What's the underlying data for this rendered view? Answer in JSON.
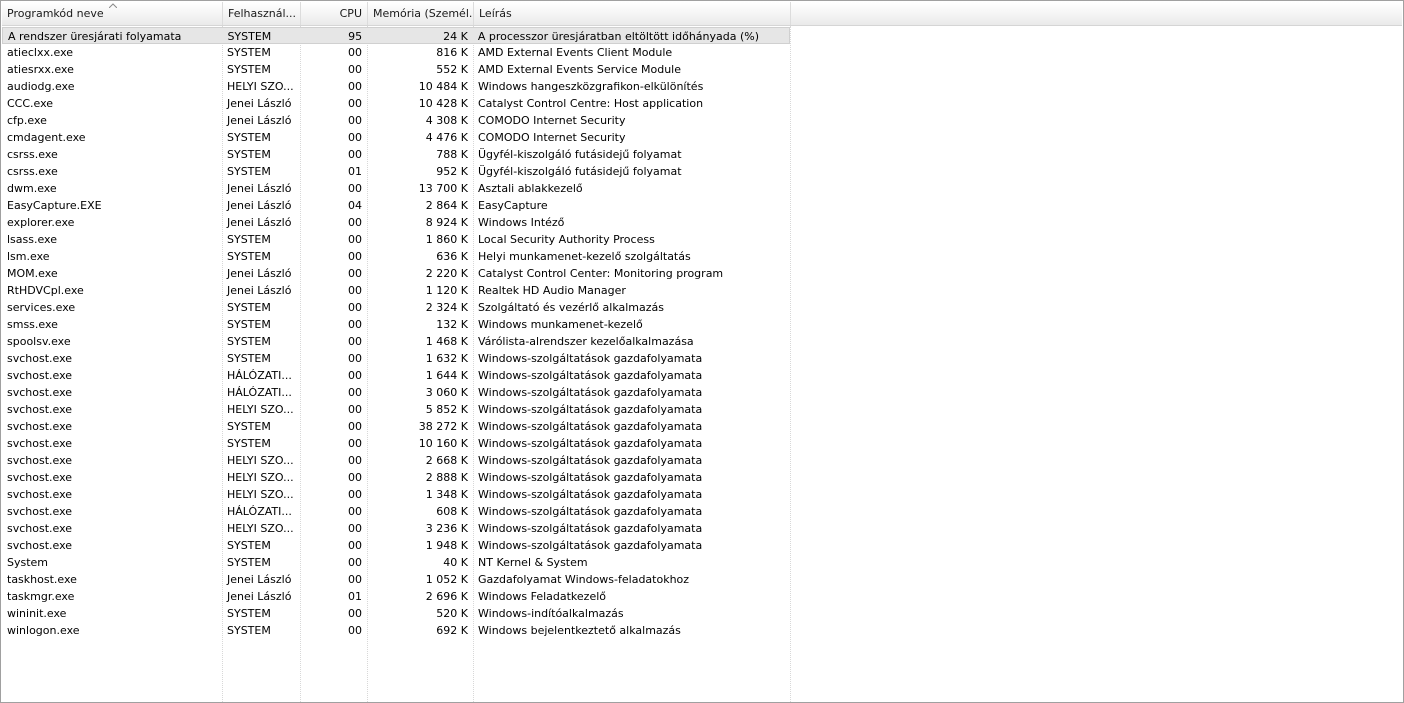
{
  "columns": {
    "name": "Programkód neve",
    "user": "Felhasznál...",
    "cpu": "CPU",
    "memory": "Memória (Személ...",
    "description": "Leírás"
  },
  "rows": [
    {
      "name": "A rendszer üresjárati folyamata",
      "user": "SYSTEM",
      "cpu": "95",
      "memory": "24 K",
      "description": "A processzor üresjáratban eltöltött időhányada (%)"
    },
    {
      "name": "atieclxx.exe",
      "user": "SYSTEM",
      "cpu": "00",
      "memory": "816 K",
      "description": "AMD External Events Client Module"
    },
    {
      "name": "atiesrxx.exe",
      "user": "SYSTEM",
      "cpu": "00",
      "memory": "552 K",
      "description": "AMD External Events Service Module"
    },
    {
      "name": "audiodg.exe",
      "user": "HELYI SZO...",
      "cpu": "00",
      "memory": "10 484 K",
      "description": "Windows hangeszközgrafikon-elkülönítés"
    },
    {
      "name": "CCC.exe",
      "user": "Jenei László",
      "cpu": "00",
      "memory": "10 428 K",
      "description": "Catalyst Control Centre: Host application"
    },
    {
      "name": "cfp.exe",
      "user": "Jenei László",
      "cpu": "00",
      "memory": "4 308 K",
      "description": "COMODO Internet Security"
    },
    {
      "name": "cmdagent.exe",
      "user": "SYSTEM",
      "cpu": "00",
      "memory": "4 476 K",
      "description": "COMODO Internet Security"
    },
    {
      "name": "csrss.exe",
      "user": "SYSTEM",
      "cpu": "00",
      "memory": "788 K",
      "description": "Ügyfél-kiszolgáló futásidejű folyamat"
    },
    {
      "name": "csrss.exe",
      "user": "SYSTEM",
      "cpu": "01",
      "memory": "952 K",
      "description": "Ügyfél-kiszolgáló futásidejű folyamat"
    },
    {
      "name": "dwm.exe",
      "user": "Jenei László",
      "cpu": "00",
      "memory": "13 700 K",
      "description": "Asztali ablakkezelő"
    },
    {
      "name": "EasyCapture.EXE",
      "user": "Jenei László",
      "cpu": "04",
      "memory": "2 864 K",
      "description": "EasyCapture"
    },
    {
      "name": "explorer.exe",
      "user": "Jenei László",
      "cpu": "00",
      "memory": "8 924 K",
      "description": "Windows Intéző"
    },
    {
      "name": "lsass.exe",
      "user": "SYSTEM",
      "cpu": "00",
      "memory": "1 860 K",
      "description": "Local Security Authority Process"
    },
    {
      "name": "lsm.exe",
      "user": "SYSTEM",
      "cpu": "00",
      "memory": "636 K",
      "description": "Helyi munkamenet-kezelő szolgáltatás"
    },
    {
      "name": "MOM.exe",
      "user": "Jenei László",
      "cpu": "00",
      "memory": "2 220 K",
      "description": "Catalyst Control Center: Monitoring program"
    },
    {
      "name": "RtHDVCpl.exe",
      "user": "Jenei László",
      "cpu": "00",
      "memory": "1 120 K",
      "description": "Realtek HD Audio Manager"
    },
    {
      "name": "services.exe",
      "user": "SYSTEM",
      "cpu": "00",
      "memory": "2 324 K",
      "description": "Szolgáltató és vezérlő alkalmazás"
    },
    {
      "name": "smss.exe",
      "user": "SYSTEM",
      "cpu": "00",
      "memory": "132 K",
      "description": "Windows munkamenet-kezelő"
    },
    {
      "name": "spoolsv.exe",
      "user": "SYSTEM",
      "cpu": "00",
      "memory": "1 468 K",
      "description": "Várólista-alrendszer kezelőalkalmazása"
    },
    {
      "name": "svchost.exe",
      "user": "SYSTEM",
      "cpu": "00",
      "memory": "1 632 K",
      "description": "Windows-szolgáltatások gazdafolyamata"
    },
    {
      "name": "svchost.exe",
      "user": "HÁLÓZATI...",
      "cpu": "00",
      "memory": "1 644 K",
      "description": "Windows-szolgáltatások gazdafolyamata"
    },
    {
      "name": "svchost.exe",
      "user": "HÁLÓZATI...",
      "cpu": "00",
      "memory": "3 060 K",
      "description": "Windows-szolgáltatások gazdafolyamata"
    },
    {
      "name": "svchost.exe",
      "user": "HELYI SZO...",
      "cpu": "00",
      "memory": "5 852 K",
      "description": "Windows-szolgáltatások gazdafolyamata"
    },
    {
      "name": "svchost.exe",
      "user": "SYSTEM",
      "cpu": "00",
      "memory": "38 272 K",
      "description": "Windows-szolgáltatások gazdafolyamata"
    },
    {
      "name": "svchost.exe",
      "user": "SYSTEM",
      "cpu": "00",
      "memory": "10 160 K",
      "description": "Windows-szolgáltatások gazdafolyamata"
    },
    {
      "name": "svchost.exe",
      "user": "HELYI SZO...",
      "cpu": "00",
      "memory": "2 668 K",
      "description": "Windows-szolgáltatások gazdafolyamata"
    },
    {
      "name": "svchost.exe",
      "user": "HELYI SZO...",
      "cpu": "00",
      "memory": "2 888 K",
      "description": "Windows-szolgáltatások gazdafolyamata"
    },
    {
      "name": "svchost.exe",
      "user": "HELYI SZO...",
      "cpu": "00",
      "memory": "1 348 K",
      "description": "Windows-szolgáltatások gazdafolyamata"
    },
    {
      "name": "svchost.exe",
      "user": "HÁLÓZATI...",
      "cpu": "00",
      "memory": "608 K",
      "description": "Windows-szolgáltatások gazdafolyamata"
    },
    {
      "name": "svchost.exe",
      "user": "HELYI SZO...",
      "cpu": "00",
      "memory": "3 236 K",
      "description": "Windows-szolgáltatások gazdafolyamata"
    },
    {
      "name": "svchost.exe",
      "user": "SYSTEM",
      "cpu": "00",
      "memory": "1 948 K",
      "description": "Windows-szolgáltatások gazdafolyamata"
    },
    {
      "name": "System",
      "user": "SYSTEM",
      "cpu": "00",
      "memory": "40 K",
      "description": "NT Kernel & System"
    },
    {
      "name": "taskhost.exe",
      "user": "Jenei László",
      "cpu": "00",
      "memory": "1 052 K",
      "description": "Gazdafolyamat Windows-feladatokhoz"
    },
    {
      "name": "taskmgr.exe",
      "user": "Jenei László",
      "cpu": "01",
      "memory": "2 696 K",
      "description": "Windows Feladatkezelő"
    },
    {
      "name": "wininit.exe",
      "user": "SYSTEM",
      "cpu": "00",
      "memory": "520 K",
      "description": "Windows-indítóalkalmazás"
    },
    {
      "name": "winlogon.exe",
      "user": "SYSTEM",
      "cpu": "00",
      "memory": "692 K",
      "description": "Windows bejelentkeztető alkalmazás"
    }
  ],
  "selected_row": 0,
  "icons": {
    "sort": "sort-ascending-icon"
  },
  "colors": {
    "selection": "#e6e6e6",
    "grid": "#d8d8d8"
  }
}
